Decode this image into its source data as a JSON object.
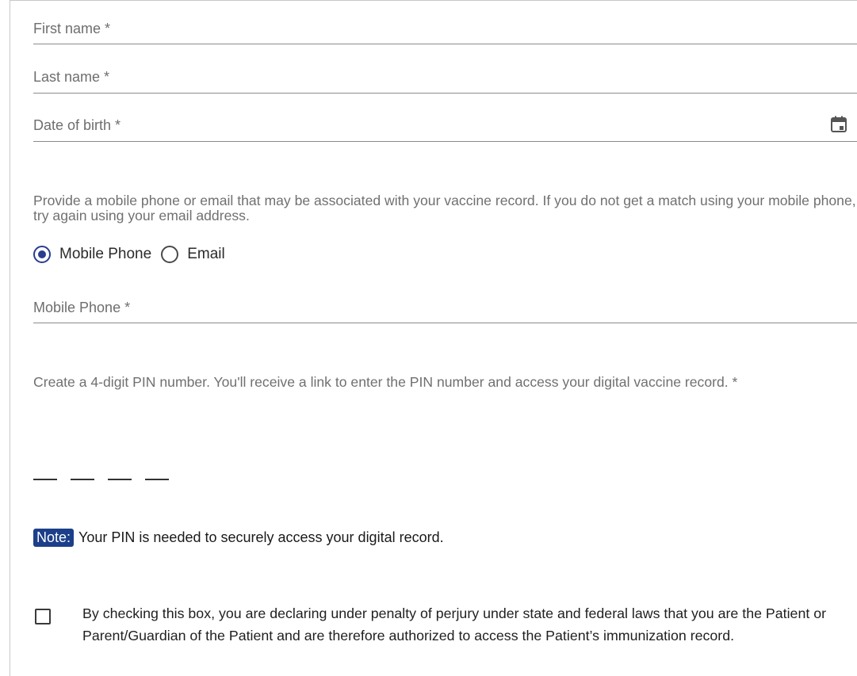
{
  "form": {
    "first_name_label": "First name *",
    "last_name_label": "Last name *",
    "dob_label": "Date of birth *",
    "contact_help": "Provide a mobile phone or email that may be associated with your vaccine record. If you do not get a match using your mobile phone, try again using your email address.",
    "contact_options": [
      {
        "label": "Mobile Phone",
        "selected": true
      },
      {
        "label": "Email",
        "selected": false
      }
    ],
    "mobile_label": "Mobile Phone *",
    "pin_help": "Create a 4-digit PIN number. You'll receive a link to enter the PIN number and access your digital vaccine record. *",
    "pin_digits": 4,
    "note_badge": "Note:",
    "note_text": "Your PIN is needed to securely access your digital record.",
    "consent_text": "By checking this box, you are declaring under penalty of perjury under state and federal laws that you are the Patient or Parent/Guardian of the Patient and are therefore authorized to access the Patient’s immunization record.",
    "consent_checked": false
  },
  "icons": {
    "calendar": "calendar-icon"
  },
  "colors": {
    "accent": "#2a3d8f",
    "note_badge_bg": "#1c3f8a"
  }
}
